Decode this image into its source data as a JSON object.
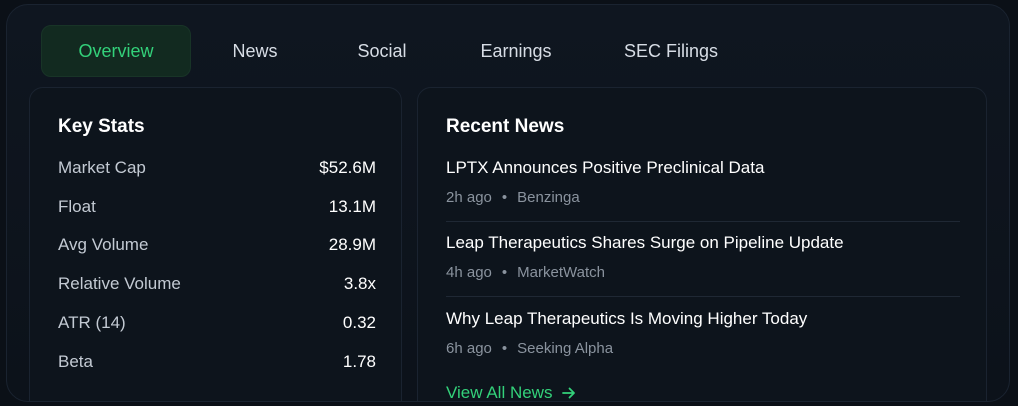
{
  "tabs": [
    {
      "label": "Overview",
      "active": true
    },
    {
      "label": "News",
      "active": false
    },
    {
      "label": "Social",
      "active": false
    },
    {
      "label": "Earnings",
      "active": false
    },
    {
      "label": "SEC Filings",
      "active": false
    }
  ],
  "key_stats": {
    "title": "Key Stats",
    "rows": [
      {
        "label": "Market Cap",
        "value": "$52.6M"
      },
      {
        "label": "Float",
        "value": "13.1M"
      },
      {
        "label": "Avg Volume",
        "value": "28.9M"
      },
      {
        "label": "Relative Volume",
        "value": "3.8x"
      },
      {
        "label": "ATR (14)",
        "value": "0.32"
      },
      {
        "label": "Beta",
        "value": "1.78"
      }
    ]
  },
  "recent_news": {
    "title": "Recent News",
    "items": [
      {
        "headline": "LPTX Announces Positive Preclinical Data",
        "time": "2h ago",
        "source": "Benzinga"
      },
      {
        "headline": "Leap Therapeutics Shares Surge on Pipeline Update",
        "time": "4h ago",
        "source": "MarketWatch"
      },
      {
        "headline": "Why Leap Therapeutics Is Moving Higher Today",
        "time": "6h ago",
        "source": "Seeking Alpha"
      }
    ],
    "view_all_label": "View All News",
    "separator": "•"
  },
  "colors": {
    "accent": "#33d17a",
    "background": "#0b1017",
    "card": "#0d141c"
  },
  "icons": {
    "view_all": "arrow-right-icon"
  }
}
